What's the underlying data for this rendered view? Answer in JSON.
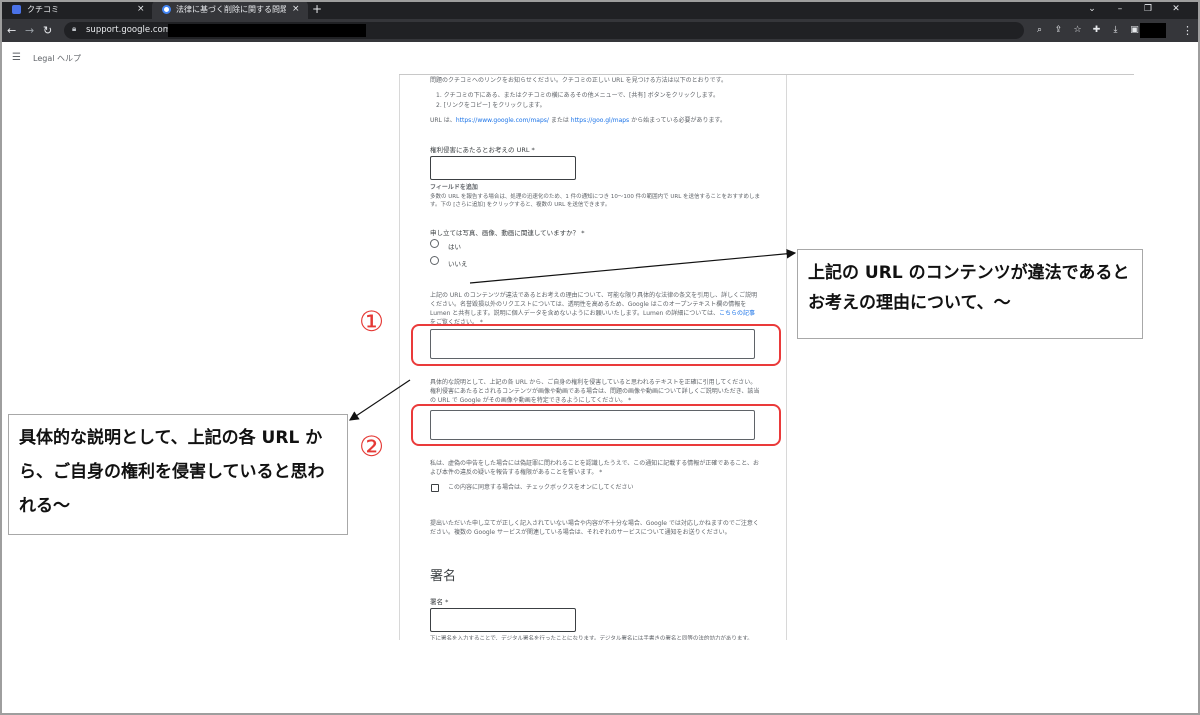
{
  "browser": {
    "tabs": [
      {
        "title": "クチコミ",
        "active": false
      },
      {
        "title": "法律に基づく削除に関する問題を報",
        "active": true
      }
    ],
    "close_glyph": "×",
    "new_tab_glyph": "+",
    "url": "support.google.com",
    "icons": [
      "back-icon",
      "forward-icon",
      "reload-icon",
      "lock-icon",
      "zoom-icon",
      "share-icon",
      "bookmark-star-icon",
      "extensions-icon",
      "download-icon",
      "sidepanel-icon",
      "menu-kebab-icon"
    ]
  },
  "app": {
    "brand": "Legal ヘルプ"
  },
  "form": {
    "intro": "問題のクチコミへのリンクをお知らせください。クチコミの正しい URL を見つける方法は以下のとおりです。",
    "steps": [
      "1. クチコミの下にある、またはクチコミの横にあるその他メニューで、[共有] ボタンをクリックします。",
      "2. [リンクをコピー] をクリックします。"
    ],
    "url_note_prefix": "URL は、",
    "url_link_1": "https://www.google.com/maps/",
    "url_note_mid": " または ",
    "url_link_2": "https://goo.gl/maps",
    "url_note_suffix": " から始まっている必要があります。",
    "url_field_label": "権利侵害にあたるとお考えの URL *",
    "add_field": "フィールドを追加",
    "add_field_note": "多数の URL を報告する場合は、処理の迅速化のため、1 件の通知につき 10～100 件の範囲内で URL を送信することをおすすめします。下の [さらに追加] をクリックすると、複数の URL を送信できます。",
    "media_question": "申し立ては写真、画像、動画に関連していますか？ *",
    "radio_yes": "はい",
    "radio_no": "いいえ",
    "reason_label_main": "上記の URL のコンテンツが違法であるとお考えの理由について、可能な限り具体的な法律の条文を引用し、詳しくご説明ください。名誉毀損以外のリクエストについては、透明性を高めるため、Google はこのオープンテキスト欄の情報を Lumen と共有します。説明に個人データを含めないようにお願いいたします。Lumen の詳細については、",
    "reason_label_link": "こちらの記事",
    "reason_label_end": "をご覧ください。 *",
    "detail_label": "具体的な説明として、上記の各 URL から、ご自身の権利を侵害していると思われるテキストを正確に引用してください。権利侵害にあたるとされるコンテンツが画像や動画である場合は、問題の画像や動画について詳しくご説明いただき、該当の URL で Google がその画像や動画を特定できるようにしてください。 *",
    "declaration": "私は、虚偽の申告をした場合には偽証罪に問われることを認識したうえで、この通知に記載する情報が正確であること、および本件の違反の疑いを報告する権限があることを誓います。 *",
    "checkbox_label": "この内容に同意する場合は、チェックボックスをオンにしてください",
    "notice": "提出いただいた申し立てが正しく記入されていない場合や内容が不十分な場合、Google では対応しかねますのでご注意ください。複数の Google サービスが関連している場合は、それぞれのサービスについて通知をお送りください。",
    "signature_title": "署名",
    "signature_label": "署名 *",
    "signature_note": "下に署名を入力することで、デジタル署名を行ったことになります。デジタル署名には手書きの署名と同等の法的効力があります。"
  },
  "annotations": {
    "marker_1": "①",
    "marker_2": "②",
    "callout_1": "上記の URL のコンテンツが違法であるとお考えの理由について、～",
    "callout_2": "具体的な説明として、上記の各 URL から、ご自身の権利を侵害していると思われる～",
    "accent_color": "#e53935"
  }
}
